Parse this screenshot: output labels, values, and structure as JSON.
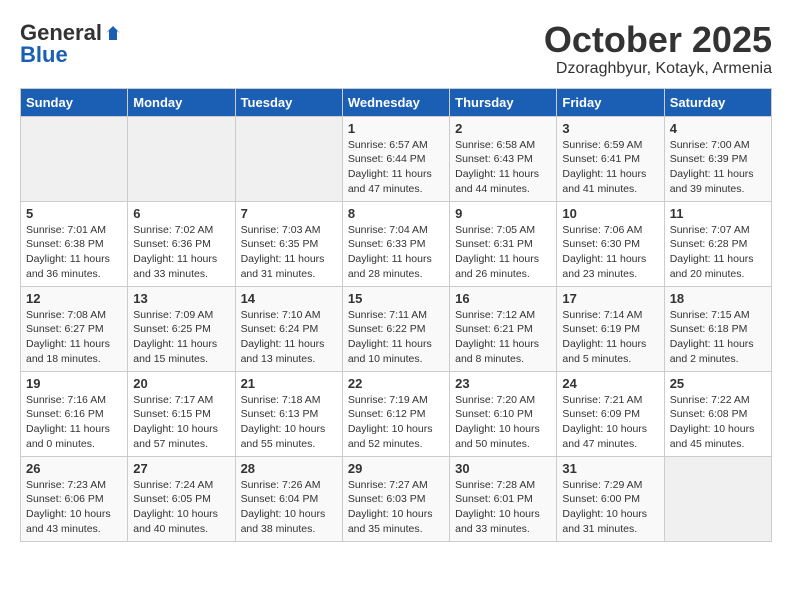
{
  "logo": {
    "general": "General",
    "blue": "Blue"
  },
  "header": {
    "month": "October 2025",
    "location": "Dzoraghbyur, Kotayk, Armenia"
  },
  "weekdays": [
    "Sunday",
    "Monday",
    "Tuesday",
    "Wednesday",
    "Thursday",
    "Friday",
    "Saturday"
  ],
  "weeks": [
    [
      {
        "day": "",
        "sunrise": "",
        "sunset": "",
        "daylight": "",
        "empty": true
      },
      {
        "day": "",
        "sunrise": "",
        "sunset": "",
        "daylight": "",
        "empty": true
      },
      {
        "day": "",
        "sunrise": "",
        "sunset": "",
        "daylight": "",
        "empty": true
      },
      {
        "day": "1",
        "sunrise": "Sunrise: 6:57 AM",
        "sunset": "Sunset: 6:44 PM",
        "daylight": "Daylight: 11 hours and 47 minutes."
      },
      {
        "day": "2",
        "sunrise": "Sunrise: 6:58 AM",
        "sunset": "Sunset: 6:43 PM",
        "daylight": "Daylight: 11 hours and 44 minutes."
      },
      {
        "day": "3",
        "sunrise": "Sunrise: 6:59 AM",
        "sunset": "Sunset: 6:41 PM",
        "daylight": "Daylight: 11 hours and 41 minutes."
      },
      {
        "day": "4",
        "sunrise": "Sunrise: 7:00 AM",
        "sunset": "Sunset: 6:39 PM",
        "daylight": "Daylight: 11 hours and 39 minutes."
      }
    ],
    [
      {
        "day": "5",
        "sunrise": "Sunrise: 7:01 AM",
        "sunset": "Sunset: 6:38 PM",
        "daylight": "Daylight: 11 hours and 36 minutes."
      },
      {
        "day": "6",
        "sunrise": "Sunrise: 7:02 AM",
        "sunset": "Sunset: 6:36 PM",
        "daylight": "Daylight: 11 hours and 33 minutes."
      },
      {
        "day": "7",
        "sunrise": "Sunrise: 7:03 AM",
        "sunset": "Sunset: 6:35 PM",
        "daylight": "Daylight: 11 hours and 31 minutes."
      },
      {
        "day": "8",
        "sunrise": "Sunrise: 7:04 AM",
        "sunset": "Sunset: 6:33 PM",
        "daylight": "Daylight: 11 hours and 28 minutes."
      },
      {
        "day": "9",
        "sunrise": "Sunrise: 7:05 AM",
        "sunset": "Sunset: 6:31 PM",
        "daylight": "Daylight: 11 hours and 26 minutes."
      },
      {
        "day": "10",
        "sunrise": "Sunrise: 7:06 AM",
        "sunset": "Sunset: 6:30 PM",
        "daylight": "Daylight: 11 hours and 23 minutes."
      },
      {
        "day": "11",
        "sunrise": "Sunrise: 7:07 AM",
        "sunset": "Sunset: 6:28 PM",
        "daylight": "Daylight: 11 hours and 20 minutes."
      }
    ],
    [
      {
        "day": "12",
        "sunrise": "Sunrise: 7:08 AM",
        "sunset": "Sunset: 6:27 PM",
        "daylight": "Daylight: 11 hours and 18 minutes."
      },
      {
        "day": "13",
        "sunrise": "Sunrise: 7:09 AM",
        "sunset": "Sunset: 6:25 PM",
        "daylight": "Daylight: 11 hours and 15 minutes."
      },
      {
        "day": "14",
        "sunrise": "Sunrise: 7:10 AM",
        "sunset": "Sunset: 6:24 PM",
        "daylight": "Daylight: 11 hours and 13 minutes."
      },
      {
        "day": "15",
        "sunrise": "Sunrise: 7:11 AM",
        "sunset": "Sunset: 6:22 PM",
        "daylight": "Daylight: 11 hours and 10 minutes."
      },
      {
        "day": "16",
        "sunrise": "Sunrise: 7:12 AM",
        "sunset": "Sunset: 6:21 PM",
        "daylight": "Daylight: 11 hours and 8 minutes."
      },
      {
        "day": "17",
        "sunrise": "Sunrise: 7:14 AM",
        "sunset": "Sunset: 6:19 PM",
        "daylight": "Daylight: 11 hours and 5 minutes."
      },
      {
        "day": "18",
        "sunrise": "Sunrise: 7:15 AM",
        "sunset": "Sunset: 6:18 PM",
        "daylight": "Daylight: 11 hours and 2 minutes."
      }
    ],
    [
      {
        "day": "19",
        "sunrise": "Sunrise: 7:16 AM",
        "sunset": "Sunset: 6:16 PM",
        "daylight": "Daylight: 11 hours and 0 minutes."
      },
      {
        "day": "20",
        "sunrise": "Sunrise: 7:17 AM",
        "sunset": "Sunset: 6:15 PM",
        "daylight": "Daylight: 10 hours and 57 minutes."
      },
      {
        "day": "21",
        "sunrise": "Sunrise: 7:18 AM",
        "sunset": "Sunset: 6:13 PM",
        "daylight": "Daylight: 10 hours and 55 minutes."
      },
      {
        "day": "22",
        "sunrise": "Sunrise: 7:19 AM",
        "sunset": "Sunset: 6:12 PM",
        "daylight": "Daylight: 10 hours and 52 minutes."
      },
      {
        "day": "23",
        "sunrise": "Sunrise: 7:20 AM",
        "sunset": "Sunset: 6:10 PM",
        "daylight": "Daylight: 10 hours and 50 minutes."
      },
      {
        "day": "24",
        "sunrise": "Sunrise: 7:21 AM",
        "sunset": "Sunset: 6:09 PM",
        "daylight": "Daylight: 10 hours and 47 minutes."
      },
      {
        "day": "25",
        "sunrise": "Sunrise: 7:22 AM",
        "sunset": "Sunset: 6:08 PM",
        "daylight": "Daylight: 10 hours and 45 minutes."
      }
    ],
    [
      {
        "day": "26",
        "sunrise": "Sunrise: 7:23 AM",
        "sunset": "Sunset: 6:06 PM",
        "daylight": "Daylight: 10 hours and 43 minutes."
      },
      {
        "day": "27",
        "sunrise": "Sunrise: 7:24 AM",
        "sunset": "Sunset: 6:05 PM",
        "daylight": "Daylight: 10 hours and 40 minutes."
      },
      {
        "day": "28",
        "sunrise": "Sunrise: 7:26 AM",
        "sunset": "Sunset: 6:04 PM",
        "daylight": "Daylight: 10 hours and 38 minutes."
      },
      {
        "day": "29",
        "sunrise": "Sunrise: 7:27 AM",
        "sunset": "Sunset: 6:03 PM",
        "daylight": "Daylight: 10 hours and 35 minutes."
      },
      {
        "day": "30",
        "sunrise": "Sunrise: 7:28 AM",
        "sunset": "Sunset: 6:01 PM",
        "daylight": "Daylight: 10 hours and 33 minutes."
      },
      {
        "day": "31",
        "sunrise": "Sunrise: 7:29 AM",
        "sunset": "Sunset: 6:00 PM",
        "daylight": "Daylight: 10 hours and 31 minutes."
      },
      {
        "day": "",
        "sunrise": "",
        "sunset": "",
        "daylight": "",
        "empty": true
      }
    ]
  ]
}
